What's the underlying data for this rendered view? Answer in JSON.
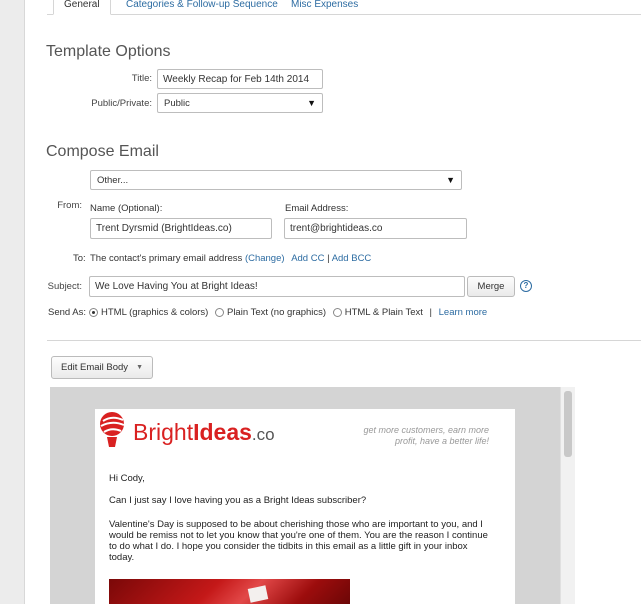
{
  "tabs": [
    "General",
    "Categories & Follow-up Sequence",
    "Misc Expenses"
  ],
  "template_options": {
    "heading": "Template Options",
    "title_label": "Title:",
    "title_value": "Weekly Recap for Feb 14th 2014",
    "public_label": "Public/Private:",
    "public_value": "Public"
  },
  "compose": {
    "heading": "Compose Email",
    "from_label": "From:",
    "from_select": "Other...",
    "name_label": "Name (Optional):",
    "name_value": "Trent Dyrsmid (BrightIdeas.co)",
    "email_label": "Email Address:",
    "email_value": "trent@brightideas.co",
    "to_label": "To:",
    "to_text": "The contact's primary email address",
    "change_link": "(Change)",
    "add_cc": "Add CC",
    "sep": "|",
    "add_bcc": "Add BCC",
    "subject_label": "Subject:",
    "subject_value": "We Love Having You at Bright Ideas!",
    "merge_button": "Merge",
    "help_icon_text": "?",
    "send_as_label": "Send As:",
    "send_html": "HTML (graphics & colors)",
    "send_plain": "Plain Text (no graphics)",
    "send_both": "HTML & Plain Text",
    "learn_more": "Learn more"
  },
  "editor": {
    "edit_button": "Edit Email Body",
    "logo_bright": "Bright",
    "logo_ideas": "Ideas",
    "logo_co": ".co",
    "tagline_1": "get more customers, earn more",
    "tagline_2": "profit, have a better life!",
    "greeting": "Hi Cody,",
    "p1": "Can I just say I love having you as a Bright Ideas subscriber?",
    "p2_l1": "Valentine's Day is supposed to be about cherishing those who are important to you, and I",
    "p2_l2": "would be remiss not to let you know that you're one of them. You are the reason I continue",
    "p2_l3": "to do what I do. I hope you consider the tidbits in this email as a little gift in your inbox",
    "p2_l4": "today."
  },
  "colors": {
    "link": "#2d6ca2",
    "brand_red": "#d92121",
    "heading": "#555555"
  },
  "icons": {
    "dropdown": "caret-down-icon",
    "help": "help-circle-icon",
    "logo": "bright-ideas-logo-icon"
  }
}
